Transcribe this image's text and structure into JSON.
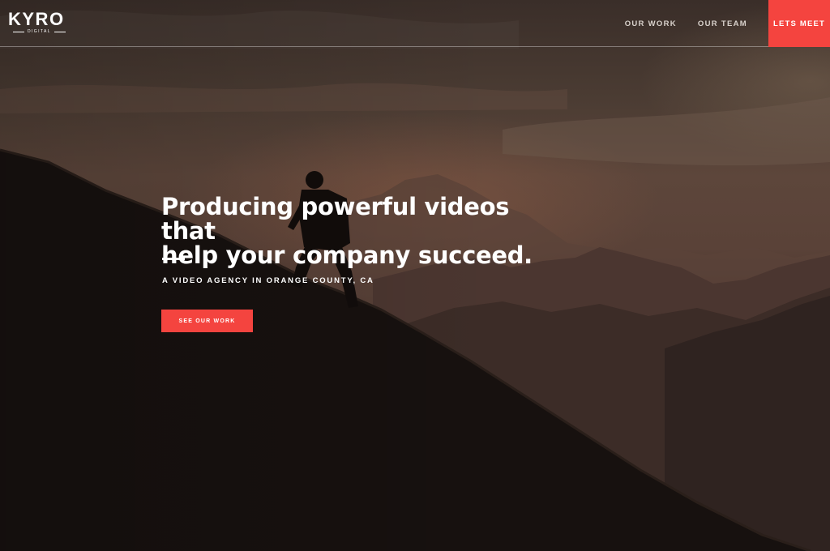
{
  "brand": {
    "logo_text": "KYRO",
    "logo_subtext": "DIGITAL"
  },
  "nav": {
    "items": [
      {
        "label": "OUR WORK"
      },
      {
        "label": "OUR TEAM"
      }
    ],
    "cta_label": "LETS MEET"
  },
  "hero": {
    "headline_line1": "Producing powerful videos that",
    "headline_line2": "help your company succeed.",
    "subtitle": "A VIDEO AGENCY IN ORANGE COUNTY, CA",
    "button_label": "SEE OUR WORK",
    "background_description_icon": "mountain-hiker-photo"
  },
  "colors": {
    "accent": "#f4443f",
    "text": "#ffffff",
    "nav_text": "#d9d2cc"
  }
}
